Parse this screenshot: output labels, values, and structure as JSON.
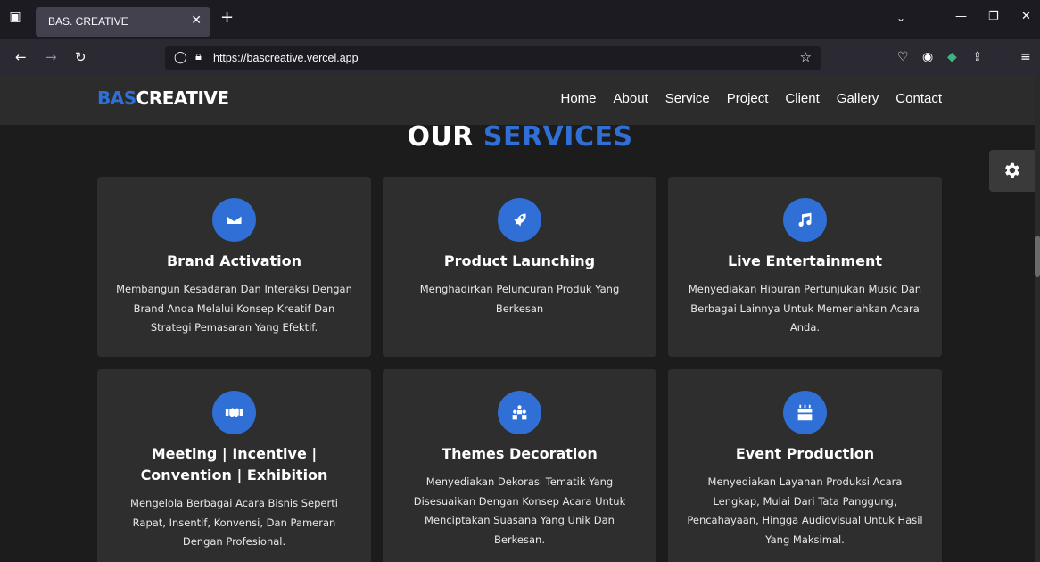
{
  "browser": {
    "tab_title": "BAS. CREATIVE",
    "url": "https://bascreative.vercel.app"
  },
  "site": {
    "logo_accent": "BAS",
    "logo_main": "CREATIVE",
    "menu": [
      "Home",
      "About",
      "Service",
      "Project",
      "Client",
      "Gallery",
      "Contact"
    ],
    "section_title_white": "OUR",
    "section_title_blue": "SERVICES"
  },
  "services": [
    {
      "icon": "envelope-icon",
      "title": "Brand Activation",
      "desc": "Membangun Kesadaran Dan Interaksi Dengan Brand Anda Melalui Konsep Kreatif Dan Strategi Pemasaran Yang Efektif."
    },
    {
      "icon": "rocket-icon",
      "title": "Product Launching",
      "desc": "Menghadirkan Peluncuran Produk Yang Berkesan"
    },
    {
      "icon": "music-icon",
      "title": "Live Entertainment",
      "desc": "Menyediakan Hiburan Pertunjukan Music Dan Berbagai Lainnya Untuk Memeriahkan Acara Anda."
    },
    {
      "icon": "handshake-icon",
      "title": "Meeting | Incentive | Convention | Exhibition",
      "desc": "Mengelola Berbagai Acara Bisnis Seperti Rapat, Insentif, Konvensi, Dan Pameran Dengan Profesional."
    },
    {
      "icon": "people-icon",
      "title": "Themes Decoration",
      "desc": "Menyediakan Dekorasi Tematik Yang Disesuaikan Dengan Konsep Acara Untuk Menciptakan Suasana Yang Unik Dan Berkesan."
    },
    {
      "icon": "cake-icon",
      "title": "Event Production",
      "desc": "Menyediakan Layanan Produksi Acara Lengkap, Mulai Dari Tata Panggung, Pencahayaan, Hingga Audiovisual Untuk Hasil Yang Maksimal."
    }
  ],
  "colors": {
    "accent": "#2f6fd6",
    "card_bg": "#2e2e2e",
    "page_bg": "#1c1c1c",
    "header_bg": "#2c2c2c"
  }
}
